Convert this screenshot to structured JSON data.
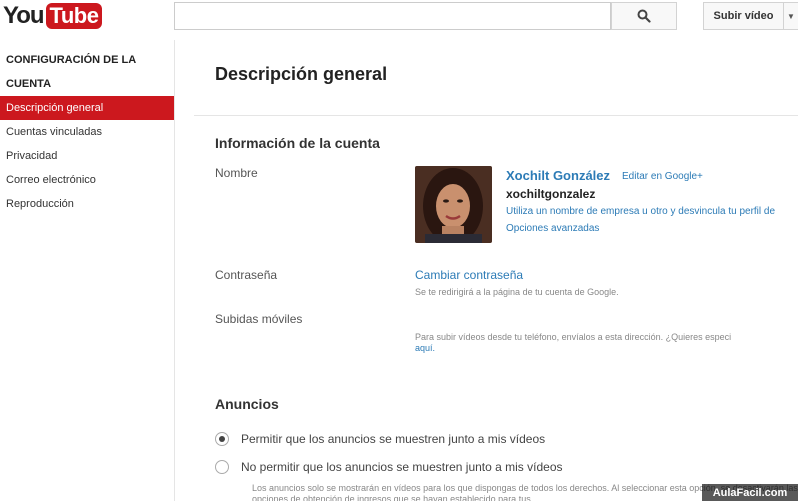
{
  "header": {
    "logo_you": "You",
    "logo_tube": "Tube",
    "search": {
      "value": "",
      "placeholder": ""
    },
    "search_icon": "search-icon",
    "upload_label": "Subir vídeo",
    "upload_menu_icon": "triangle-down-icon"
  },
  "sidebar": {
    "heading": "CONFIGURACIÓN DE LA CUENTA",
    "items": [
      {
        "label": "Descripción general",
        "active": true
      },
      {
        "label": "Cuentas vinculadas",
        "active": false
      },
      {
        "label": "Privacidad",
        "active": false
      },
      {
        "label": "Correo electrónico",
        "active": false
      },
      {
        "label": "Reproducción",
        "active": false
      }
    ]
  },
  "main": {
    "title": "Descripción general",
    "account_section": {
      "title": "Información de la cuenta",
      "name_label": "Nombre",
      "user_name": "Xochilt González",
      "edit_link": "Editar en Google+",
      "username": "xochiltgonzalez",
      "business_link": "Utiliza un nombre de empresa u otro y desvincula tu perfil de",
      "advanced_link": "Opciones avanzadas",
      "password_label": "Contraseña",
      "password_link": "Cambiar contraseña",
      "password_desc": "Se te redirigirá a la página de tu cuenta de Google.",
      "mobile_label": "Subidas móviles",
      "mobile_desc": "Para subir vídeos desde tu teléfono, envíalos a esta dirección. ¿Quieres especi",
      "mobile_link": "aquí."
    },
    "ads_section": {
      "title": "Anuncios",
      "option_allow": "Permitir que los anuncios se muestren junto a mis vídeos",
      "option_deny": "No permitir que los anuncios se muestren junto a mis vídeos",
      "selected": "allow",
      "note": "Los anuncios solo se mostrarán en vídeos para los que dispongas de todos los derechos. Al seleccionar esta opción, se desactivarán las opciones de obtención de ingresos que se hayan establecido para tus"
    }
  },
  "watermark": "AulaFacil.com",
  "colors": {
    "brand_red": "#cc181e",
    "link_blue": "#2c7bb6"
  }
}
